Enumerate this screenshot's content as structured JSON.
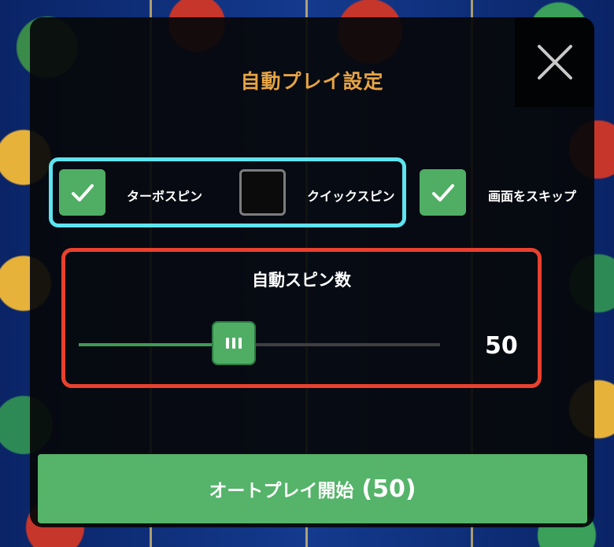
{
  "dialog": {
    "title": "自動プレイ設定",
    "close_icon": "close-x-icon"
  },
  "options": [
    {
      "label": "ターボスピン",
      "checked": true
    },
    {
      "label": "クイックスピン",
      "checked": false
    },
    {
      "label": "画面をスキップ",
      "checked": true
    }
  ],
  "auto_spin": {
    "title": "自動スピン数",
    "value": "50",
    "slider_fraction": 0.43
  },
  "start_button": {
    "label": "オートプレイ開始",
    "count": "(50)"
  },
  "colors": {
    "accent_green": "#4fae64",
    "title_orange": "#e7a443",
    "highlight_cyan": "#5fe3ef",
    "highlight_red": "#e8412e"
  }
}
